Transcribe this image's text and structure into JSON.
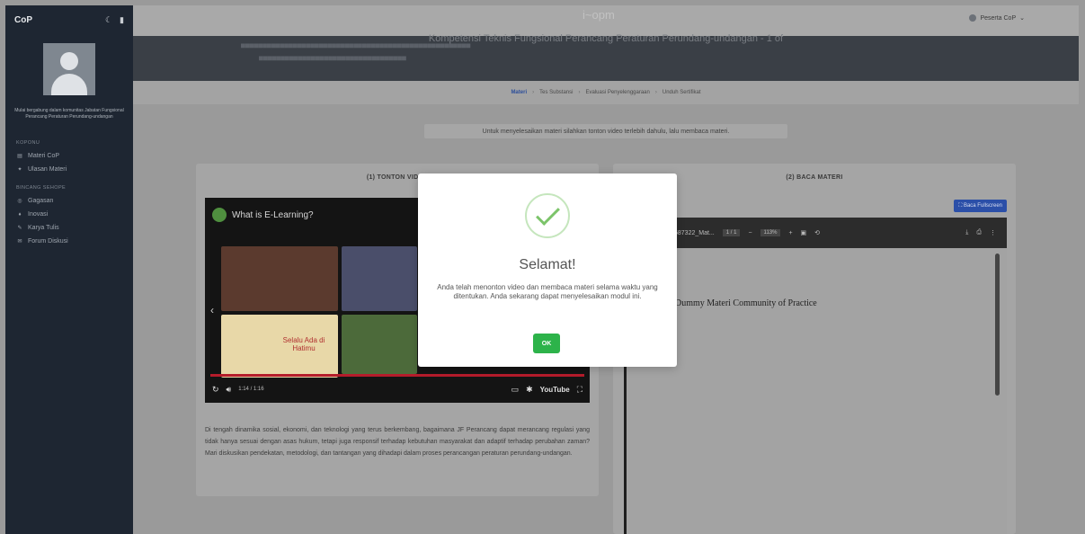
{
  "sidebar": {
    "brand": "CoP",
    "caption": "Mulai bergabung dalam komunitas Jabatan Fungsional Perancang Peraturan Perundang-undangan",
    "section1": "KOPONU",
    "items1": [
      {
        "label": "Materi CoP",
        "icon": "book-icon"
      },
      {
        "label": "Ulasan Materi",
        "icon": "star-icon"
      }
    ],
    "section2": "BINCANG SEHOPE",
    "items2": [
      {
        "label": "Gagasan",
        "icon": "bulb-icon"
      },
      {
        "label": "Inovasi",
        "icon": "rocket-icon"
      },
      {
        "label": "Karya Tulis",
        "icon": "pen-icon"
      },
      {
        "label": "Forum Diskusi",
        "icon": "chat-icon"
      }
    ]
  },
  "topbar": {
    "user": "Peserta CoP",
    "faded_title": "i~opm"
  },
  "banner": {
    "title": "Kompetensi Teknis Fungsional Perancang Peraturan Perundang-undangan - 1 of"
  },
  "breadcrumb": {
    "items": [
      "Materi",
      "Tes Substansi",
      "Evaluasi Penyelenggaraan",
      "Unduh Sertifikat"
    ]
  },
  "info": "Untuk menyelesaikan materi silahkan tonton video terlebih dahulu, lalu membaca materi.",
  "left_card": {
    "heading": "(1) TONTON VIDEO",
    "video": {
      "title": "What is E-Learning?",
      "time": "1:14 / 1:16",
      "thumb_text": "Selalu Ada di Hatimu",
      "platform": "YouTube"
    },
    "paragraph": "Di tengah dinamika sosial, ekonomi, dan teknologi yang terus berkembang, bagaimana JF Perancang dapat merancang regulasi yang tidak hanya sesuai dengan asas hukum, tetapi juga responsif terhadap kebutuhan masyarakat dan adaptif terhadap perubahan zaman? Mari diskusikan pendekatan, metodologi, dan tantangan yang dihadapi dalam proses perancangan peraturan perundang-undangan."
  },
  "right_card": {
    "heading": "(2) BACA MATERI",
    "fullscreen": "Baca Fullscreen",
    "pdf": {
      "filename": "587322_Mat...",
      "page": "1 / 1",
      "zoom": "113%",
      "content": "Dummy Materi Community of Practice"
    }
  },
  "modal": {
    "title": "Selamat!",
    "message": "Anda telah menonton video dan membaca materi selama waktu yang ditentukan. Anda sekarang dapat menyelesaikan modul ini.",
    "ok": "OK"
  }
}
